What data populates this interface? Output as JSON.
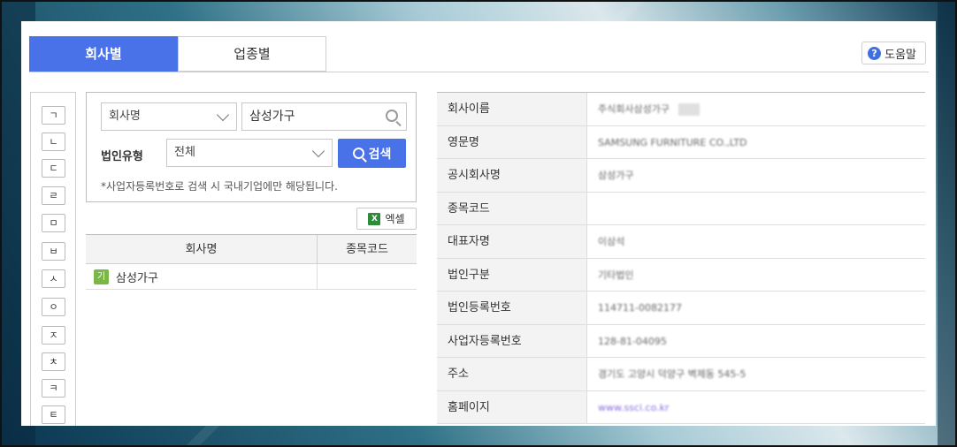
{
  "tabs": [
    {
      "label": "회사별",
      "active": true
    },
    {
      "label": "업종별",
      "active": false
    }
  ],
  "help_label": "도움말",
  "consonants": [
    "ㄱ",
    "ㄴ",
    "ㄷ",
    "ㄹ",
    "ㅁ",
    "ㅂ",
    "ㅅ",
    "ㅇ",
    "ㅈ",
    "ㅊ",
    "ㅋ",
    "ㅌ"
  ],
  "search": {
    "field_select": "회사명",
    "keyword": "삼성가구",
    "type_label": "법인유형",
    "type_select": "전체",
    "button_label": "검색",
    "note": "*사업자등록번호로 검색 시 국내기업에만 해당됩니다."
  },
  "excel_label": "엑셀",
  "list": {
    "headers": [
      "회사명",
      "종목코드"
    ],
    "rows": [
      {
        "badge": "기",
        "name": "삼성가구",
        "code": ""
      }
    ]
  },
  "detail": {
    "rows": [
      {
        "label": "회사이름",
        "value": "주식회사삼성가구"
      },
      {
        "label": "영문명",
        "value": "SAMSUNG FURNITURE CO.,LTD"
      },
      {
        "label": "공시회사명",
        "value": "삼성가구"
      },
      {
        "label": "종목코드",
        "value": ""
      },
      {
        "label": "대표자명",
        "value": "이삼석"
      },
      {
        "label": "법인구분",
        "value": "기타법인"
      },
      {
        "label": "법인등록번호",
        "value": "114711-0082177"
      },
      {
        "label": "사업자등록번호",
        "value": "128-81-04095"
      },
      {
        "label": "주소",
        "value": "경기도 고양시 덕양구 벽제동 545-5"
      },
      {
        "label": "홈페이지",
        "value": "www.ssci.co.kr"
      }
    ]
  },
  "colors": {
    "accent": "#4a72e8",
    "badge": "#7ab648"
  }
}
